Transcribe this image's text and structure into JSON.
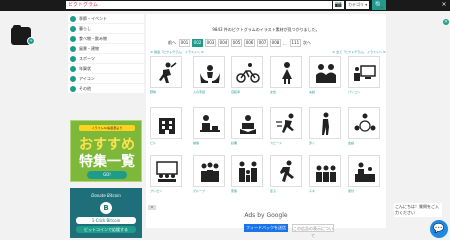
{
  "header": {
    "search_value": "ピクトグラム",
    "select_label": "カテゴリ ▾",
    "search_glyph": "🔍",
    "camera_glyph": "📷",
    "close_glyph": "×",
    "close_right_glyph": "×"
  },
  "logo": {
    "badge": "+"
  },
  "sidebar": {
    "items": [
      {
        "label": "季節・イベント"
      },
      {
        "label": "暮らし"
      },
      {
        "label": "食べ物・飲み物"
      },
      {
        "label": "風景・建物"
      },
      {
        "label": "スポーツ"
      },
      {
        "label": "年賀状"
      },
      {
        "label": "アイコン"
      },
      {
        "label": "その他"
      }
    ]
  },
  "banner1": {
    "caption": "イラストAC編集部より",
    "line1": "おすすめ",
    "line2": "特集一覧",
    "button": "GO!"
  },
  "banner2": {
    "title": "Donate Bitcoin",
    "coin": "B",
    "btn1": "1-Click Bitcoin",
    "btn2": "ビットコインで応援する"
  },
  "results": {
    "count_text": "9843 件のピクトグラムのイラスト素材が見つかりました。",
    "pager": {
      "prev": "前へ",
      "next": "次へ",
      "pages": [
        "001",
        "002",
        "003",
        "004",
        "005",
        "006",
        "007",
        "008",
        "...",
        "111"
      ],
      "active_index": 1
    },
    "sort_left": "≪ 関連「ピクトグラム」 イラストへ ≫",
    "sort_right": "≪ 全て「ピクトグラム」 イラストへ ≫",
    "tiles": [
      {
        "caption": "野球",
        "icon": "baseball-player-icon"
      },
      {
        "caption": "人の手話",
        "icon": "hands-person-icon"
      },
      {
        "caption": "自転車",
        "icon": "cyclist-icon"
      },
      {
        "caption": "女性",
        "icon": "woman-icon"
      },
      {
        "caption": "夫婦",
        "icon": "couple-icon"
      },
      {
        "caption": "パソコン",
        "icon": "computer-user-icon"
      },
      {
        "caption": "ビル",
        "icon": "building-icon"
      },
      {
        "caption": "勉強",
        "icon": "studying-icon"
      },
      {
        "caption": "読書",
        "icon": "reading-icon"
      },
      {
        "caption": "スピード",
        "icon": "runner-speed-icon"
      },
      {
        "caption": "歩く",
        "icon": "walking-person-icon"
      },
      {
        "caption": "会議",
        "icon": "meeting-circle-icon"
      },
      {
        "caption": "プレゼン",
        "icon": "presentation-icon"
      },
      {
        "caption": "グループ",
        "icon": "group-people-icon"
      },
      {
        "caption": "家族",
        "icon": "family-icon"
      },
      {
        "caption": "走る",
        "icon": "running-person-icon"
      },
      {
        "caption": "人々",
        "icon": "people-row-icon"
      },
      {
        "caption": "受付",
        "icon": "reception-desk-icon"
      }
    ]
  },
  "ads": {
    "label": "Ads by Google",
    "feedback": "フィードバックを送信",
    "reason": "この広告の表示について",
    "small": "X"
  },
  "chat": {
    "message": "こんにちは！質問をご入力ください",
    "glyph": "💬"
  }
}
